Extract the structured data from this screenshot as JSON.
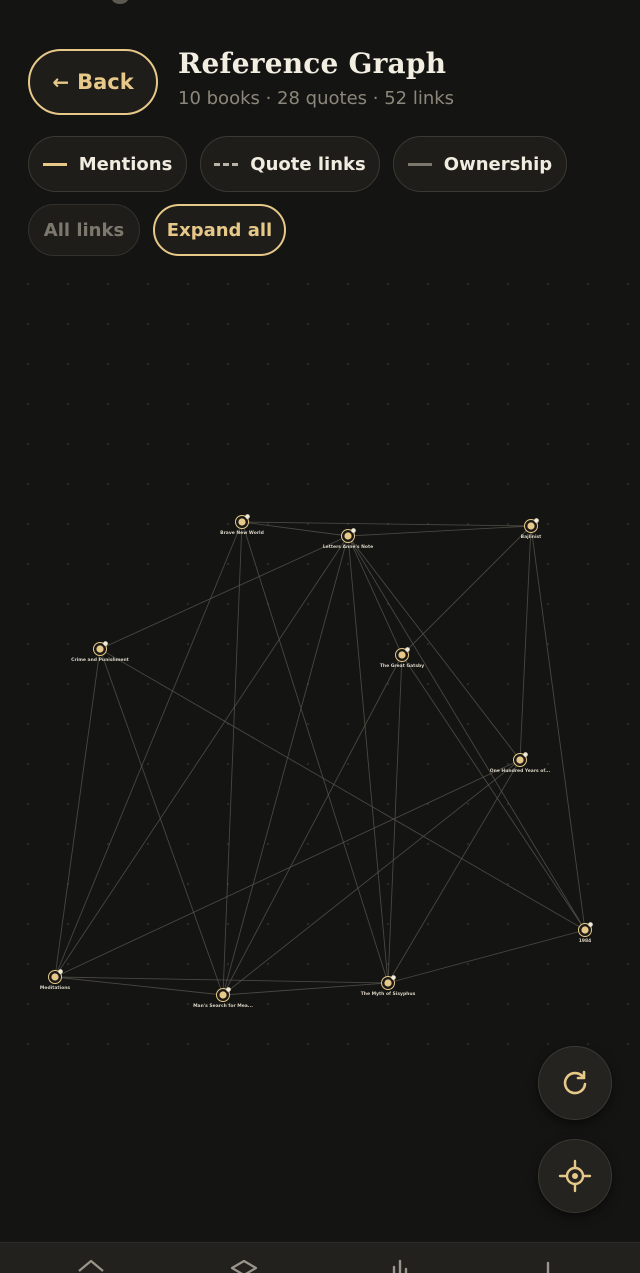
{
  "header": {
    "back_label": "Back",
    "title": "Reference Graph",
    "subtitle": "10 books · 28 quotes · 52 links"
  },
  "legend": [
    {
      "label": "Mentions",
      "style": "solid",
      "color": "#e6c889"
    },
    {
      "label": "Quote links",
      "style": "dashed",
      "color": "#b8b3a6"
    },
    {
      "label": "Ownership",
      "style": "solid",
      "color": "#7b776d"
    }
  ],
  "filters": {
    "all_links_label": "All links",
    "expand_all_label": "Expand all"
  },
  "graph": {
    "nodes": [
      {
        "id": "brave",
        "label": "Brave New World"
      },
      {
        "id": "anne",
        "label": "Letters Anne's Note"
      },
      {
        "id": "ruby",
        "label": "Bajlinist"
      },
      {
        "id": "crime",
        "label": "Crime and Punishment"
      },
      {
        "id": "gatsby",
        "label": "The Great Gatsby"
      },
      {
        "id": "hundred",
        "label": "One Hundred Years of..."
      },
      {
        "id": "n1984",
        "label": "1984"
      },
      {
        "id": "medit",
        "label": "Meditations"
      },
      {
        "id": "mans",
        "label": "Man's Search for Mea..."
      },
      {
        "id": "sisyphus",
        "label": "The Myth of Sisyphus"
      }
    ],
    "edges": [
      [
        "brave",
        "anne"
      ],
      [
        "brave",
        "ruby"
      ],
      [
        "anne",
        "ruby"
      ],
      [
        "brave",
        "medit"
      ],
      [
        "brave",
        "mans"
      ],
      [
        "brave",
        "sisyphus"
      ],
      [
        "anne",
        "crime"
      ],
      [
        "anne",
        "gatsby"
      ],
      [
        "anne",
        "mans"
      ],
      [
        "anne",
        "sisyphus"
      ],
      [
        "anne",
        "medit"
      ],
      [
        "anne",
        "n1984"
      ],
      [
        "anne",
        "hundred"
      ],
      [
        "ruby",
        "gatsby"
      ],
      [
        "ruby",
        "hundred"
      ],
      [
        "ruby",
        "n1984"
      ],
      [
        "crime",
        "medit"
      ],
      [
        "crime",
        "mans"
      ],
      [
        "crime",
        "n1984"
      ],
      [
        "gatsby",
        "mans"
      ],
      [
        "gatsby",
        "sisyphus"
      ],
      [
        "gatsby",
        "n1984"
      ],
      [
        "hundred",
        "medit"
      ],
      [
        "hundred",
        "mans"
      ],
      [
        "hundred",
        "sisyphus"
      ],
      [
        "medit",
        "mans"
      ],
      [
        "medit",
        "sisyphus"
      ],
      [
        "mans",
        "sisyphus"
      ],
      [
        "sisyphus",
        "n1984"
      ]
    ]
  },
  "fabs": {
    "refresh_icon": "refresh-icon",
    "center_icon": "crosshair-icon"
  },
  "nav": [
    "home-icon",
    "layers-icon",
    "stats-icon",
    "more-icon"
  ],
  "colors": {
    "background": "#141412",
    "accent": "#e6c889",
    "chip_bg": "#1e1d1a",
    "edge": "#5b5850"
  }
}
